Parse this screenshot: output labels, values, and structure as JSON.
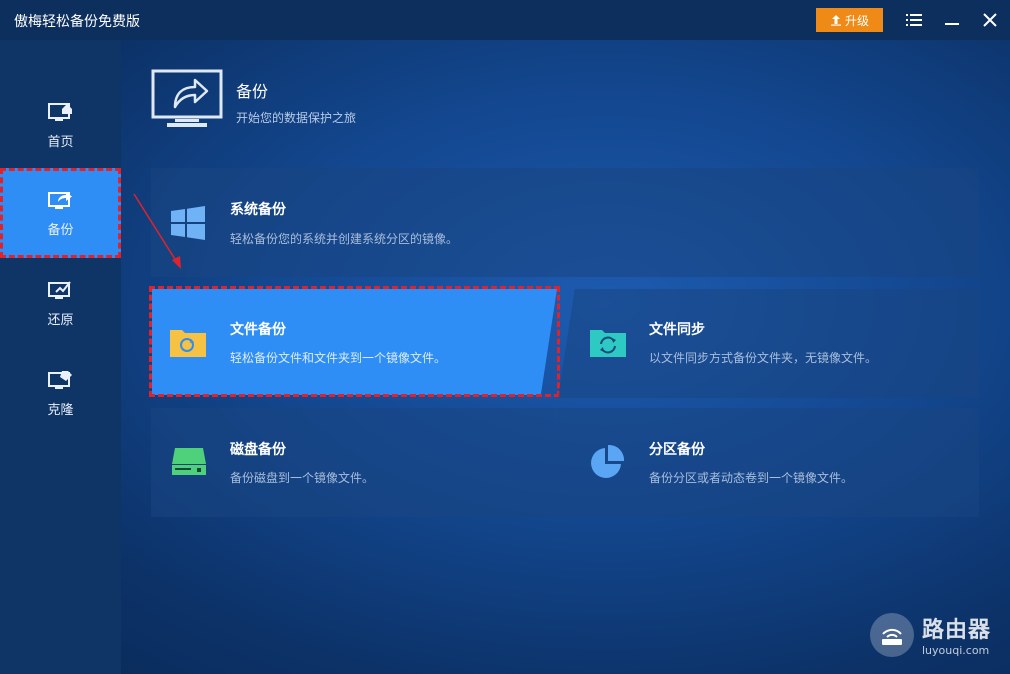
{
  "app": {
    "title": "傲梅轻松备份免费版"
  },
  "titlebar": {
    "upgrade_label": "升级"
  },
  "sidebar": {
    "items": [
      {
        "label": "首页",
        "icon": "home-monitor-icon"
      },
      {
        "label": "备份",
        "icon": "backup-monitor-icon",
        "active": true
      },
      {
        "label": "还原",
        "icon": "restore-monitor-icon"
      },
      {
        "label": "克隆",
        "icon": "clone-monitor-icon"
      }
    ]
  },
  "header": {
    "title": "备份",
    "subtitle": "开始您的数据保护之旅"
  },
  "cards": {
    "system_backup": {
      "title": "系统备份",
      "desc": "轻松备份您的系统并创建系统分区的镜像。"
    },
    "file_backup": {
      "title": "文件备份",
      "desc": "轻松备份文件和文件夹到一个镜像文件。"
    },
    "file_sync": {
      "title": "文件同步",
      "desc": "以文件同步方式备份文件夹，无镜像文件。"
    },
    "disk_backup": {
      "title": "磁盘备份",
      "desc": "备份磁盘到一个镜像文件。"
    },
    "partition_backup": {
      "title": "分区备份",
      "desc": "备份分区或者动态卷到一个镜像文件。"
    }
  },
  "watermark": {
    "name": "路由器",
    "domain": "luyouqi.com"
  },
  "colors": {
    "accent": "#2f8ef5",
    "upgrade": "#f08a16",
    "highlight_border": "#e2222b",
    "folder_yellow": "#f5c243",
    "sync_teal": "#2fc9c3",
    "disk_green": "#4fd07a",
    "pie_blue": "#5aa6f5"
  }
}
